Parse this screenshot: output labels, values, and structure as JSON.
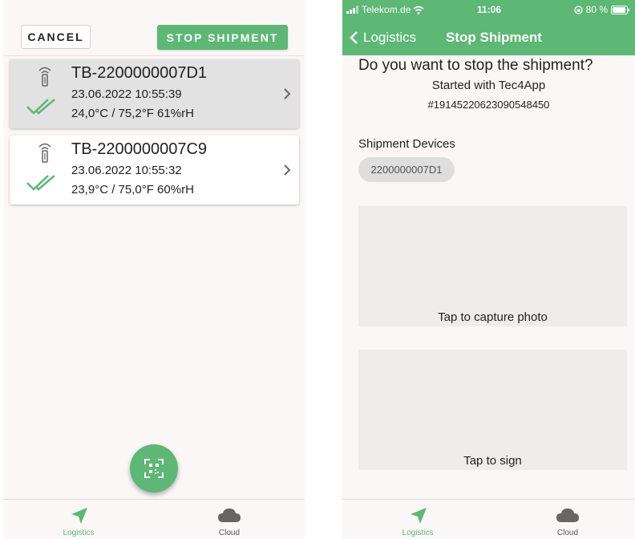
{
  "left": {
    "cancel_label": "CANCEL",
    "stop_label": "STOP SHIPMENT",
    "devices": [
      {
        "id": "TB-2200000007D1",
        "datetime": "23.06.2022 10:55:39",
        "reading": "24,0°C / 75,2°F  61%rH",
        "selected": true
      },
      {
        "id": "TB-2200000007C9",
        "datetime": "23.06.2022 10:55:32",
        "reading": "23,9°C / 75,0°F  60%rH",
        "selected": false
      }
    ],
    "fab_icon": "qr-scan-icon"
  },
  "tabs": [
    {
      "label": "Logistics",
      "icon": "navigation-arrow-icon",
      "active": true
    },
    {
      "label": "Cloud",
      "icon": "cloud-icon",
      "active": false
    }
  ],
  "right": {
    "status": {
      "carrier": "Telekom.de",
      "time": "11:06",
      "battery": "80 %"
    },
    "nav": {
      "back_label": "Logistics",
      "title": "Stop Shipment"
    },
    "question": "Do you want to stop the shipment?",
    "started_with": "Started with Tec4App",
    "shipment_id": "#19145220623090548450",
    "devices_label": "Shipment Devices",
    "device_chip": "2200000007D1",
    "photo_label": "Tap to capture photo",
    "sign_label": "Tap to sign"
  },
  "colors": {
    "accent": "#5cb874",
    "background": "#fbf7f7",
    "selected_card": "#e2e2e2"
  }
}
